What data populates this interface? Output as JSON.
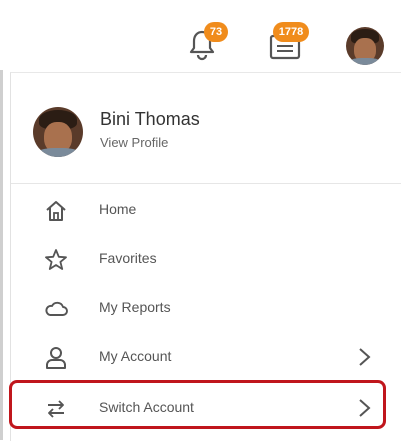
{
  "header": {
    "notifications_badge": "73",
    "inbox_badge": "1778",
    "icons": [
      "bell-icon",
      "inbox-icon"
    ]
  },
  "profile": {
    "name": "Bini Thomas",
    "link": "View Profile"
  },
  "menu": {
    "items": [
      {
        "label": "Home",
        "icon": "home-icon",
        "has_submenu": false
      },
      {
        "label": "Favorites",
        "icon": "star-icon",
        "has_submenu": false
      },
      {
        "label": "My Reports",
        "icon": "cloud-icon",
        "has_submenu": false
      },
      {
        "label": "My Account",
        "icon": "person-icon",
        "has_submenu": true
      },
      {
        "label": "Switch Account",
        "icon": "switch-arrows-icon",
        "has_submenu": true,
        "highlighted": true
      }
    ]
  },
  "colors": {
    "badge": "#f08c1c",
    "highlight_border": "#c0161c"
  }
}
